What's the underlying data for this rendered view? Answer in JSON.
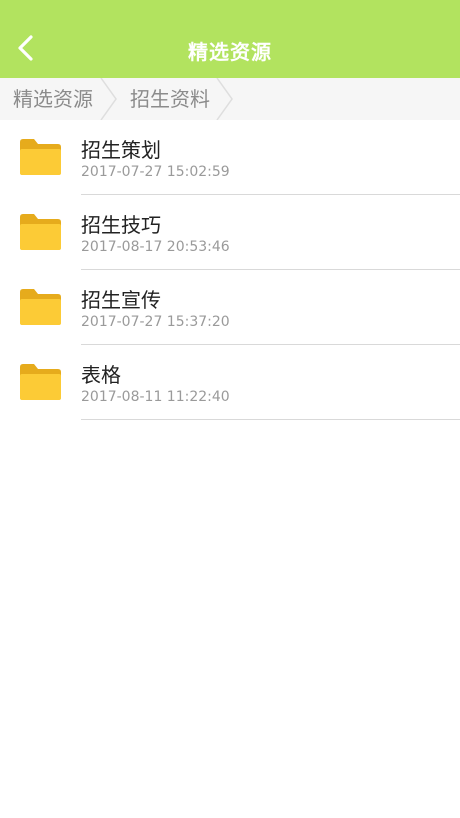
{
  "header": {
    "title": "精选资源",
    "back_icon": "chevron-left-icon",
    "background_color": "#b2e35f"
  },
  "breadcrumb": {
    "items": [
      {
        "label": "精选资源"
      },
      {
        "label": "招生资料"
      }
    ]
  },
  "files": {
    "folder_icon": "folder-icon",
    "folder_color": "#f9c630",
    "items": [
      {
        "name": "招生策划",
        "time": "2017-07-27 15:02:59"
      },
      {
        "name": "招生技巧",
        "time": "2017-08-17 20:53:46"
      },
      {
        "name": "招生宣传",
        "time": "2017-07-27 15:37:20"
      },
      {
        "name": "表格",
        "time": "2017-08-11 11:22:40"
      }
    ]
  }
}
